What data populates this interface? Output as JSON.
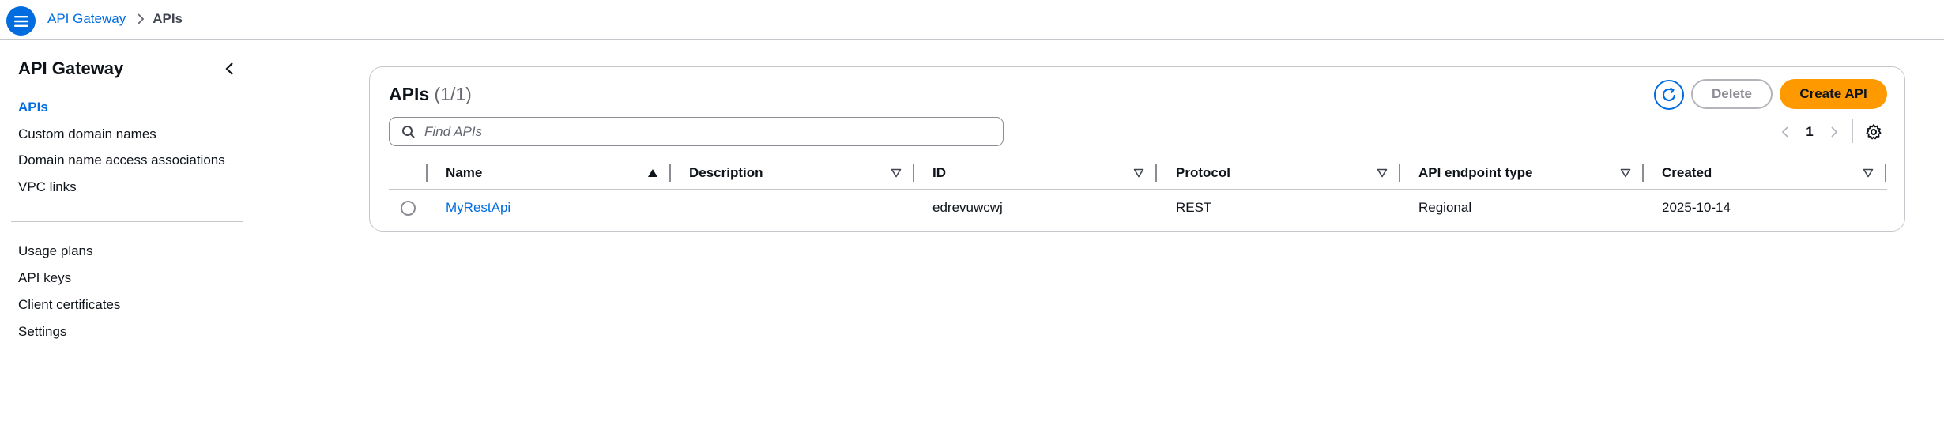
{
  "breadcrumb": {
    "root": "API Gateway",
    "current": "APIs"
  },
  "sidebar": {
    "title": "API Gateway",
    "items": [
      {
        "label": "APIs",
        "active": true
      },
      {
        "label": "Custom domain names"
      },
      {
        "label": "Domain name access associations"
      },
      {
        "label": "VPC links"
      },
      {
        "label": "Usage plans"
      },
      {
        "label": "API keys"
      },
      {
        "label": "Client certificates"
      },
      {
        "label": "Settings"
      }
    ]
  },
  "panel": {
    "title": "APIs",
    "count": "(1/1)",
    "delete_label": "Delete",
    "create_label": "Create API",
    "search_placeholder": "Find APIs",
    "page": "1"
  },
  "table": {
    "columns": [
      "Name",
      "Description",
      "ID",
      "Protocol",
      "API endpoint type",
      "Created"
    ],
    "rows": [
      {
        "name": "MyRestApi",
        "description": "",
        "id": "edrevuwcwj",
        "protocol": "REST",
        "endpoint_type": "Regional",
        "created": "2025-10-14"
      }
    ]
  },
  "colors": {
    "accent": "#006ce0",
    "primary_button": "#ff9900",
    "border": "#c6c6cd"
  },
  "icons": [
    "menu-icon",
    "chevron-right-icon",
    "chevron-left-icon",
    "refresh-icon",
    "search-icon",
    "settings-icon",
    "sort-ascending-icon",
    "sort-icon"
  ]
}
